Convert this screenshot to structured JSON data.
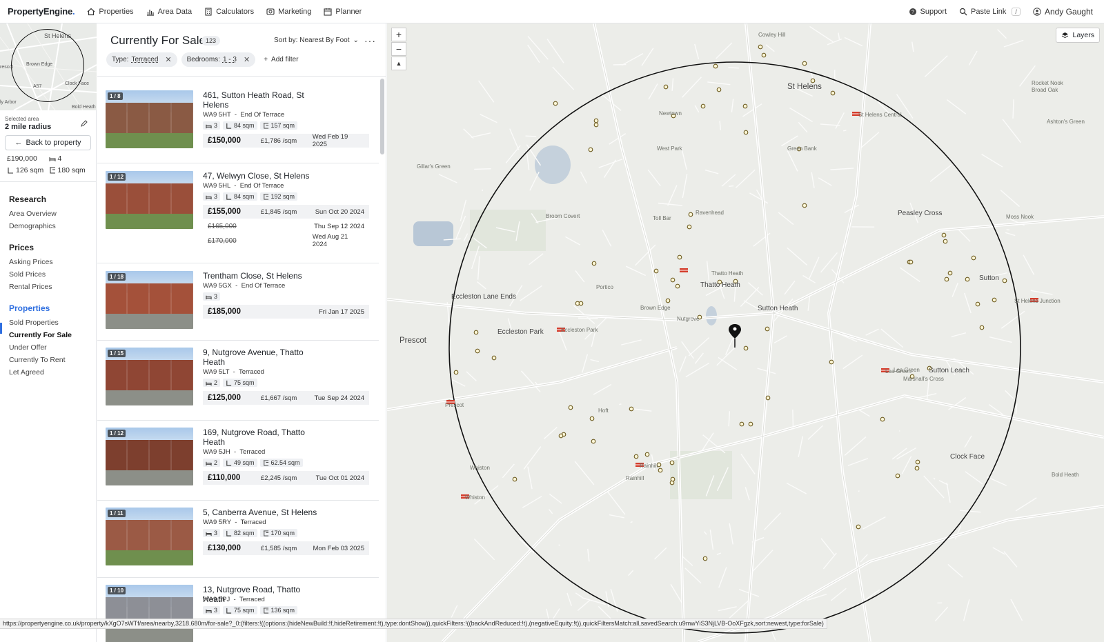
{
  "app": {
    "logo": "PropertyEngine",
    "logo_dot": "."
  },
  "nav": {
    "items": [
      {
        "label": "Properties",
        "icon": "home-icon"
      },
      {
        "label": "Area Data",
        "icon": "bar-chart-icon"
      },
      {
        "label": "Calculators",
        "icon": "calculator-icon"
      },
      {
        "label": "Marketing",
        "icon": "megaphone-icon"
      },
      {
        "label": "Planner",
        "icon": "calendar-icon"
      }
    ],
    "support": "Support",
    "paste_link": "Paste Link",
    "paste_shortcut": "/",
    "user": "Andy Gaught"
  },
  "sidebar": {
    "minimap_labels": [
      "St Helens",
      "rescot",
      "Brown Edge",
      "A57",
      "Clock Face",
      "Bold Heath",
      "ly Arbor"
    ],
    "selected_area_label": "Selected area",
    "selected_area_value": "2 mile radius",
    "back_button": "Back to property",
    "stats": {
      "price": "£190,000",
      "beds": "4",
      "size_a": "126 sqm",
      "size_b": "180 sqm"
    },
    "sections": [
      {
        "title": "Research",
        "links": [
          "Area Overview",
          "Demographics"
        ]
      },
      {
        "title": "Prices",
        "links": [
          "Asking Prices",
          "Sold Prices",
          "Rental Prices"
        ]
      },
      {
        "title": "Properties",
        "links": [
          "Sold Properties",
          "Currently For Sale",
          "Under Offer",
          "Currently To Rent",
          "Let Agreed"
        ]
      }
    ]
  },
  "listing": {
    "title": "Currently For Sale",
    "count": "123",
    "sort_label": "Sort by: Nearest By Foot",
    "more": "···",
    "filters": [
      {
        "key": "Type:",
        "value": "Terraced"
      },
      {
        "key": "Bedrooms:",
        "value": "1 - 3"
      }
    ],
    "add_filter": "Add filter",
    "cards": [
      {
        "badge": "1 / 8",
        "address": "461, Sutton Heath Road, St Helens",
        "postcode": "WA9 5HT",
        "ptype": "End Of Terrace",
        "beds": "3",
        "area1": "84 sqm",
        "area2": "157 sqm",
        "prices": [
          {
            "price": "£150,000",
            "psqm": "£1,786 /sqm",
            "date": "Wed Feb 19 2025"
          }
        ]
      },
      {
        "badge": "1 / 12",
        "address": "47, Welwyn Close, St Helens",
        "postcode": "WA9 5HL",
        "ptype": "End Of Terrace",
        "beds": "3",
        "area1": "84 sqm",
        "area2": "192 sqm",
        "prices": [
          {
            "price": "£155,000",
            "psqm": "£1,845 /sqm",
            "date": "Sun Oct 20 2024"
          },
          {
            "price": "£165,000",
            "psqm": "",
            "date": "Thu Sep 12 2024"
          },
          {
            "price": "£170,000",
            "psqm": "",
            "date": "Wed Aug 21 2024"
          }
        ]
      },
      {
        "badge": "1 / 18",
        "address": "Trentham Close, St Helens",
        "postcode": "WA9 5GX",
        "ptype": "End Of Terrace",
        "beds": "3",
        "area1": "",
        "area2": "",
        "prices": [
          {
            "price": "£185,000",
            "psqm": "",
            "date": "Fri Jan 17 2025"
          }
        ]
      },
      {
        "badge": "1 / 15",
        "address": "9, Nutgrove Avenue, Thatto Heath",
        "postcode": "WA9 5LT",
        "ptype": "Terraced",
        "beds": "2",
        "area1": "75 sqm",
        "area2": "",
        "prices": [
          {
            "price": "£125,000",
            "psqm": "£1,667 /sqm",
            "date": "Tue Sep 24 2024"
          }
        ]
      },
      {
        "badge": "1 / 12",
        "address": "169, Nutgrove Road, Thatto Heath",
        "postcode": "WA9 5JH",
        "ptype": "Terraced",
        "beds": "2",
        "area1": "49 sqm",
        "area2": "62.54 sqm",
        "prices": [
          {
            "price": "£110,000",
            "psqm": "£2,245 /sqm",
            "date": "Tue Oct 01 2024"
          }
        ]
      },
      {
        "badge": "1 / 11",
        "address": "5, Canberra Avenue, St Helens",
        "postcode": "WA9 5RY",
        "ptype": "Terraced",
        "beds": "3",
        "area1": "82 sqm",
        "area2": "170 sqm",
        "prices": [
          {
            "price": "£130,000",
            "psqm": "£1,585 /sqm",
            "date": "Mon Feb 03 2025"
          }
        ]
      },
      {
        "badge": "1 / 10",
        "address": "13, Nutgrove Road, Thatto Heath",
        "postcode": "WA9 5PJ",
        "ptype": "Terraced",
        "beds": "3",
        "area1": "75 sqm",
        "area2": "136 sqm",
        "prices": [],
        "tag": "Requires Modernisation"
      }
    ]
  },
  "map": {
    "zoom_in": "+",
    "zoom_out": "−",
    "reset": "▲",
    "layers": "Layers",
    "labels": [
      {
        "text": "St Helens",
        "cls": "xl"
      },
      {
        "text": "Prescot",
        "cls": "xl"
      },
      {
        "text": "Thatto Heath",
        "cls": "big"
      },
      {
        "text": "Sutton Heath",
        "cls": "big"
      },
      {
        "text": "Eccleston Park",
        "cls": "big"
      },
      {
        "text": "Eccleston Lane Ends",
        "cls": "big"
      },
      {
        "text": "Toll Bar",
        "cls": ""
      },
      {
        "text": "Ravenhead",
        "cls": ""
      },
      {
        "text": "Green Bank",
        "cls": ""
      },
      {
        "text": "West Park",
        "cls": ""
      },
      {
        "text": "Newtown",
        "cls": ""
      },
      {
        "text": "Portico",
        "cls": ""
      },
      {
        "text": "Nutgrove",
        "cls": ""
      },
      {
        "text": "Brown Edge",
        "cls": ""
      },
      {
        "text": "Peasley Cross",
        "cls": "big"
      },
      {
        "text": "Sutton",
        "cls": "big"
      },
      {
        "text": "Sutton Leach",
        "cls": "big"
      },
      {
        "text": "Marshall's Cross",
        "cls": ""
      },
      {
        "text": "Clock Face",
        "cls": "big"
      },
      {
        "text": "Rainhill",
        "cls": ""
      },
      {
        "text": "Whiston",
        "cls": ""
      },
      {
        "text": "Moss Nook",
        "cls": ""
      },
      {
        "text": "Rocket Nook",
        "cls": ""
      },
      {
        "text": "Broad Oak",
        "cls": ""
      },
      {
        "text": "Ashton's Green",
        "cls": ""
      },
      {
        "text": "Gillar's Green",
        "cls": ""
      },
      {
        "text": "Broom Covert",
        "cls": ""
      },
      {
        "text": "Hoft",
        "cls": ""
      },
      {
        "text": "Bold Heath",
        "cls": ""
      },
      {
        "text": "Lea Green",
        "cls": ""
      },
      {
        "text": "Cowley Hill",
        "cls": ""
      },
      {
        "text": "Thatto Heath",
        "cls": ""
      },
      {
        "text": "St Helens Junction",
        "cls": ""
      },
      {
        "text": "Eccleston Park",
        "cls": ""
      },
      {
        "text": "Whiston",
        "cls": ""
      },
      {
        "text": "Prescot",
        "cls": ""
      },
      {
        "text": "Rainhill",
        "cls": ""
      },
      {
        "text": "Lea Green",
        "cls": ""
      },
      {
        "text": "St Helens Central",
        "cls": ""
      }
    ]
  },
  "statusbar": "https://propertyengine.co.uk/property/kXgO7sWTf/area/nearby,3218.680m/for-sale?_0:(filters:!((options:(hideNewBuild:!f,hideRetirement:!t),type:dontShow)),quickFilters:!((backAndReduced:!t),(negativeEquity:!t)),quickFiltersMatch:all,savedSearch:u9mwYiS3NjLVB-OoXFgzk,sort:newest,type:forSale)"
}
